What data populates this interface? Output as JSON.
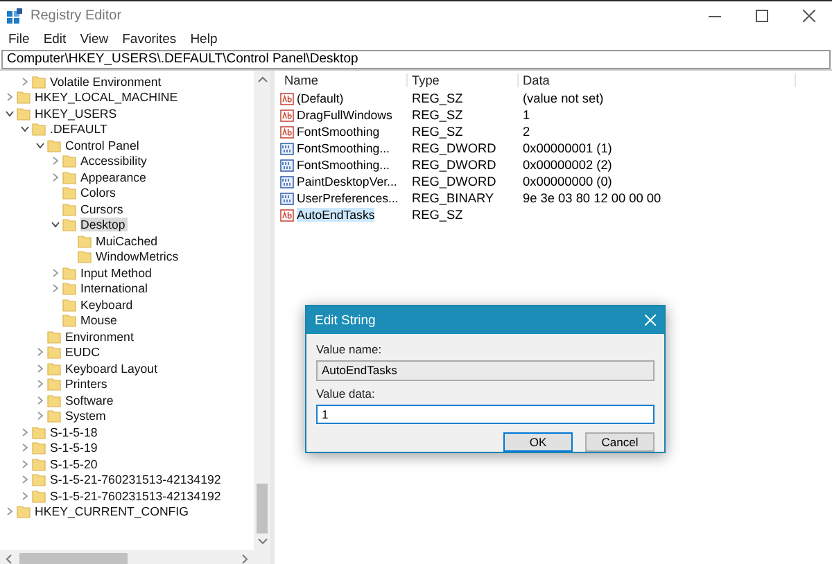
{
  "window": {
    "title": "Registry Editor"
  },
  "menu": [
    "File",
    "Edit",
    "View",
    "Favorites",
    "Help"
  ],
  "address": "Computer\\HKEY_USERS\\.DEFAULT\\Control Panel\\Desktop",
  "tree": [
    {
      "children": [
        {
          "label": "Volatile Environment",
          "expanded": false,
          "selected": false
        }
      ]
    },
    {
      "label": "HKEY_LOCAL_MACHINE",
      "expanded": false,
      "selected": false
    },
    {
      "label": "HKEY_USERS",
      "expanded": true,
      "selected": false,
      "children": [
        {
          "label": ".DEFAULT",
          "expanded": true,
          "selected": false,
          "children": [
            {
              "label": "Control Panel",
              "expanded": true,
              "selected": false,
              "children": [
                {
                  "label": "Accessibility",
                  "expanded": false,
                  "selected": false
                },
                {
                  "label": "Appearance",
                  "expanded": false,
                  "selected": false
                },
                {
                  "label": "Colors",
                  "selected": false
                },
                {
                  "label": "Cursors",
                  "selected": false
                },
                {
                  "label": "Desktop",
                  "expanded": true,
                  "selected": true,
                  "children": [
                    {
                      "label": "MuiCached",
                      "selected": false
                    },
                    {
                      "label": "WindowMetrics",
                      "selected": false
                    }
                  ]
                },
                {
                  "label": "Input Method",
                  "expanded": false,
                  "selected": false
                },
                {
                  "label": "International",
                  "expanded": false,
                  "selected": false
                },
                {
                  "label": "Keyboard",
                  "selected": false
                },
                {
                  "label": "Mouse",
                  "selected": false
                }
              ]
            },
            {
              "label": "Environment",
              "selected": false
            },
            {
              "label": "EUDC",
              "expanded": false,
              "selected": false
            },
            {
              "label": "Keyboard Layout",
              "expanded": false,
              "selected": false
            },
            {
              "label": "Printers",
              "expanded": false,
              "selected": false
            },
            {
              "label": "Software",
              "expanded": false,
              "selected": false
            },
            {
              "label": "System",
              "expanded": false,
              "selected": false
            }
          ]
        },
        {
          "label": "S-1-5-18",
          "expanded": false,
          "selected": false
        },
        {
          "label": "S-1-5-19",
          "expanded": false,
          "selected": false
        },
        {
          "label": "S-1-5-20",
          "expanded": false,
          "selected": false
        },
        {
          "label": "S-1-5-21-760231513-42134192",
          "expanded": false,
          "selected": false
        },
        {
          "label": "S-1-5-21-760231513-42134192",
          "expanded": false,
          "selected": false
        }
      ]
    },
    {
      "label": "HKEY_CURRENT_CONFIG",
      "expanded": false,
      "selected": false
    }
  ],
  "table": {
    "columns": [
      "Name",
      "Type",
      "Data"
    ],
    "rows": [
      {
        "kind": "string",
        "name": "(Default)",
        "type": "REG_SZ",
        "data": "(value not set)",
        "selected": false
      },
      {
        "kind": "string",
        "name": "DragFullWindows",
        "type": "REG_SZ",
        "data": "1",
        "selected": false
      },
      {
        "kind": "string",
        "name": "FontSmoothing",
        "type": "REG_SZ",
        "data": "2",
        "selected": false
      },
      {
        "kind": "binary",
        "name": "FontSmoothing...",
        "type": "REG_DWORD",
        "data": "0x00000001 (1)",
        "selected": false
      },
      {
        "kind": "binary",
        "name": "FontSmoothing...",
        "type": "REG_DWORD",
        "data": "0x00000002 (2)",
        "selected": false
      },
      {
        "kind": "binary",
        "name": "PaintDesktopVer...",
        "type": "REG_DWORD",
        "data": "0x00000000 (0)",
        "selected": false
      },
      {
        "kind": "binary",
        "name": "UserPreferences...",
        "type": "REG_BINARY",
        "data": "9e 3e 03 80 12 00 00 00",
        "selected": false
      },
      {
        "kind": "string",
        "name": "AutoEndTasks",
        "type": "REG_SZ",
        "selected": true
      }
    ]
  },
  "dialog": {
    "title": "Edit String",
    "name_label": "Value name:",
    "name_value": "AutoEndTasks",
    "data_label": "Value data:",
    "data_value": "1",
    "buttons": [
      "OK",
      "Cancel"
    ]
  }
}
